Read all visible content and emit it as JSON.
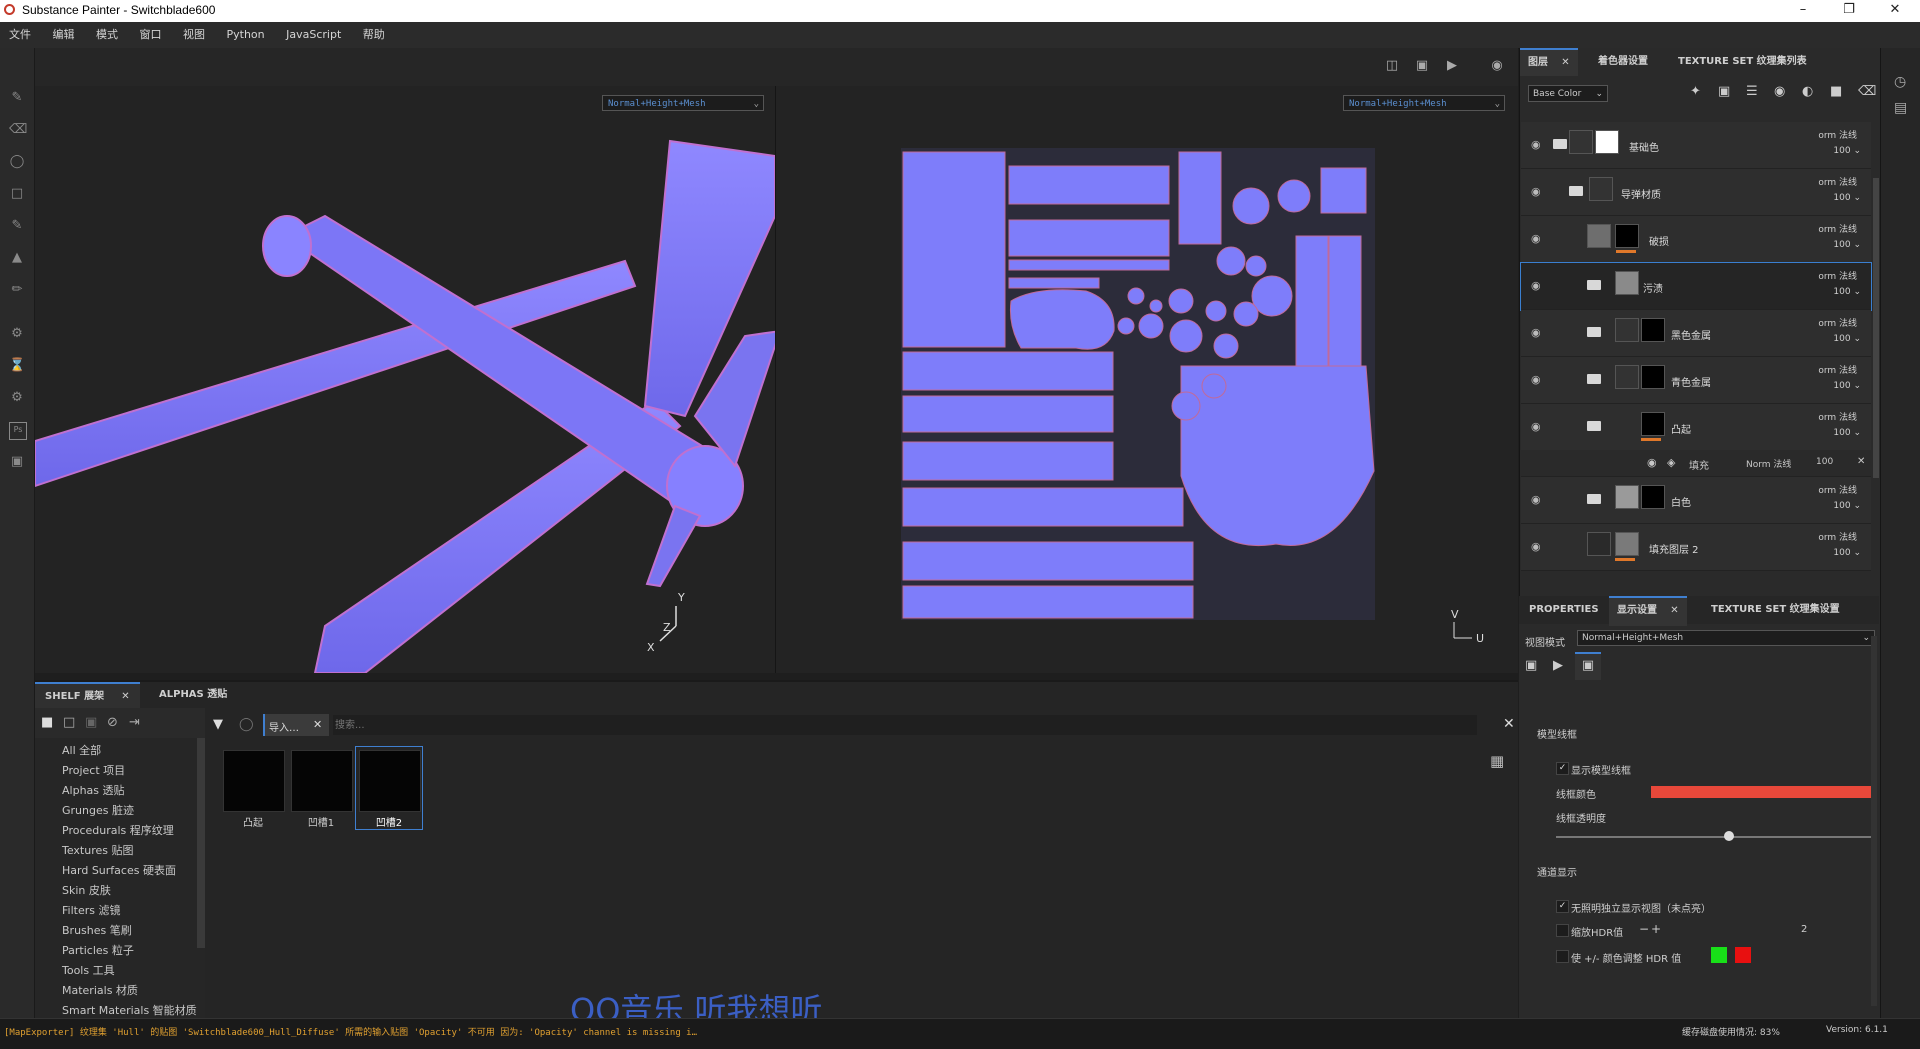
{
  "window": {
    "title": "Substance Painter - Switchblade600"
  },
  "menu": [
    "文件",
    "编辑",
    "模式",
    "窗口",
    "视图",
    "Python",
    "JavaScript",
    "帮助"
  ],
  "viewport": {
    "left_mode": "Normal+Height+Mesh",
    "right_mode": "Normal+Height+Mesh",
    "axis_y": "Y",
    "axis_z": "Z",
    "axis_x": "X",
    "uv_v": "V",
    "uv_u": "U"
  },
  "right_tabs": {
    "layers": "图层",
    "shader": "着色器设置",
    "texture_set": "TEXTURE SET 纹理集列表"
  },
  "layers_toolbar": {
    "channel": "Base Color"
  },
  "layers": [
    {
      "name": "基础色",
      "blend": "orm 法线",
      "opacity": "100"
    },
    {
      "name": "导弹材质",
      "blend": "orm 法线",
      "opacity": "100"
    },
    {
      "name": "破损",
      "blend": "orm 法线",
      "opacity": "100"
    },
    {
      "name": "污渍",
      "blend": "orm 法线",
      "opacity": "100"
    },
    {
      "name": "黑色金属",
      "blend": "orm 法线",
      "opacity": "100"
    },
    {
      "name": "青色金属",
      "blend": "orm 法线",
      "opacity": "100"
    },
    {
      "name": "凸起",
      "blend": "orm 法线",
      "opacity": "100"
    },
    {
      "name": "白色",
      "blend": "orm 法线",
      "opacity": "100"
    },
    {
      "name": "填充图层 2",
      "blend": "orm 法线",
      "opacity": "100"
    }
  ],
  "fill_sublayer": {
    "name": "填充",
    "blend": "Norm 法线",
    "opacity": "100"
  },
  "props_tabs": {
    "properties": "PROPERTIES",
    "display": "显示设置",
    "texture_set": "TEXTURE SET 纹理集设置"
  },
  "props": {
    "view_mode_label": "视图模式",
    "view_mode_value": "Normal+Height+Mesh",
    "wireframe_section": "模型线框",
    "show_wireframe": "显示模型线框",
    "wire_color": "线框颜色",
    "wire_opacity": "线框透明度",
    "wire_opacity_level": 0.55,
    "channel_section": "通道显示",
    "unlit": "无照明独立显示视图（未点亮）",
    "hdr_scale": "缩放HDR值",
    "hdr_value": "2",
    "color_adjust": "使 +/- 颜色调整 HDR 值",
    "wire_color_hex": "#e8483a"
  },
  "shelf": {
    "tab_shelf": "SHELF 展架",
    "tab_alphas": "ALPHAS 透贴",
    "filter_chip": "导入…",
    "search_placeholder": "搜索...",
    "categories": [
      "All 全部",
      "Project 项目",
      "Alphas 透贴",
      "Grunges 脏迹",
      "Procedurals 程序纹理",
      "Textures 贴图",
      "Hard Surfaces 硬表面",
      "Skin 皮肤",
      "Filters 滤镜",
      "Brushes 笔刷",
      "Particles 粒子",
      "Tools 工具",
      "Materials 材质",
      "Smart Materials 智能材质"
    ],
    "thumbs": [
      "凸起",
      "凹槽1",
      "凹槽2"
    ]
  },
  "status": {
    "message": "[MapExporter] 纹理集 'Hull' 的贴图 'Switchblade600_Hull_Diffuse' 所需的输入贴图 'Opacity' 不可用 因为: 'Opacity' channel is missing i…",
    "memory": "缓存磁盘使用情况:  83%",
    "version": "Version: 6.1.1"
  },
  "watermark": "QQ音乐 听我想听",
  "colors": {
    "accent": "#3f7fd0",
    "normal_map": "#7f7fff",
    "wire": "#e8483a"
  }
}
